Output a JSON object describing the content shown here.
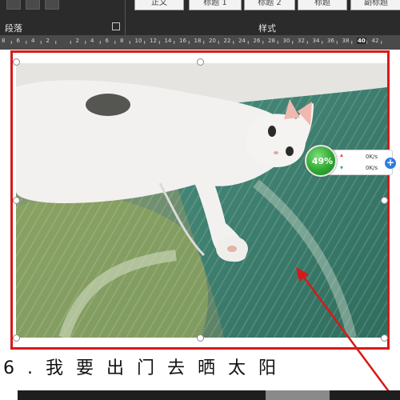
{
  "ribbon": {
    "paragraph_group_label": "段落",
    "styles_group_label": "样式",
    "style_buttons": [
      "正文",
      "标题 1",
      "标题 2",
      "标题",
      "副标题"
    ]
  },
  "ruler": {
    "numbers": [
      "8",
      "6",
      "4",
      "2",
      "",
      "2",
      "4",
      "6",
      "8",
      "10",
      "12",
      "14",
      "16",
      "18",
      "20",
      "22",
      "24",
      "26",
      "28",
      "30",
      "32",
      "34",
      "36",
      "38",
      "40",
      "42"
    ],
    "highlighted": "40"
  },
  "speed_widget": {
    "percent": "49%",
    "upload": "0K/s",
    "download": "0K/s",
    "plus": "+"
  },
  "caption": "6.我要出门去晒太阳",
  "colors": {
    "frame": "#d61a1a",
    "ribbon": "#2b2b2b",
    "ball": "#2fa832"
  }
}
